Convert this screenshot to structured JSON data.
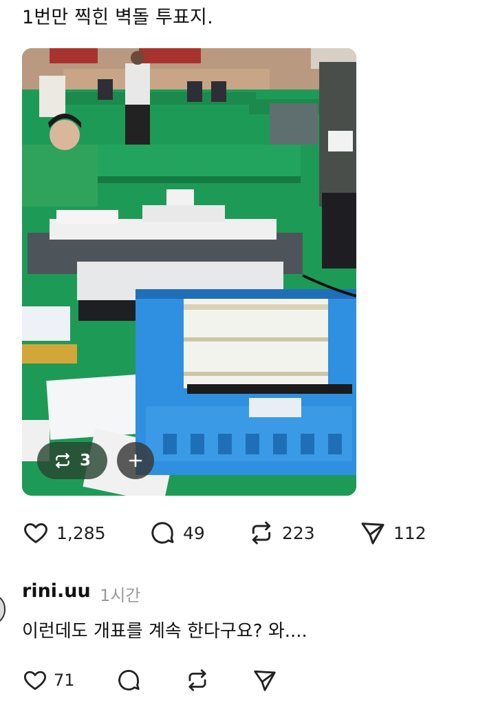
{
  "post": {
    "text": "1번만 찍힌 벽돌 투표지."
  },
  "media": {
    "repost_count": "3",
    "icons": {
      "repost": "repost-icon",
      "add": "plus-icon"
    }
  },
  "actions": {
    "likes": "1,285",
    "comments": "49",
    "reposts": "223",
    "shares": "112",
    "icons": [
      "heart-icon",
      "comment-icon",
      "repost-icon",
      "send-icon"
    ]
  },
  "comment": {
    "username": "rini.uu",
    "time": "1시간",
    "text": "이런데도 개표를 계속 한다구요? 와....",
    "likes": "71",
    "icons": [
      "heart-icon",
      "comment-icon",
      "repost-icon",
      "send-icon"
    ]
  },
  "colors": {
    "table_green": "#1f8a4a",
    "crate_blue": "#2f8fe0",
    "muted": "#9a9a9a"
  }
}
